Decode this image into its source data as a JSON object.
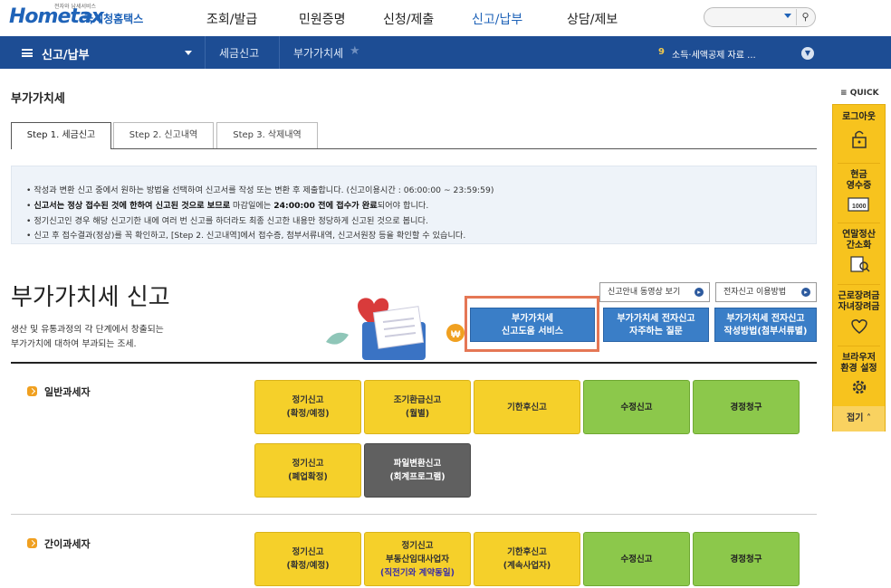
{
  "header": {
    "logo_tagline": "전자와 납세서비스",
    "logo_text": "Hometax",
    "logo_subtitle": "국세청홈택스",
    "nav": [
      "조회/발급",
      "민원증명",
      "신청/제출",
      "신고/납부",
      "상담/제보"
    ]
  },
  "menubar": {
    "title": "신고/납부",
    "crumb1": "세금신고",
    "crumb2": "부가가치세",
    "news_num": "9",
    "news_text": "소득·세액공제 자료 ..."
  },
  "page": {
    "title": "부가가치세",
    "tabs": [
      "Step 1. 세금신고",
      "Step 2. 신고내역",
      "Step 3. 삭제내역"
    ]
  },
  "info": {
    "line1": "작성과 변환 신고 중에서 원하는 방법을 선택하여 신고서를 작성 또는 변환 후 제출합니다. (신고이용시간 : 06:00:00 ~ 23:59:59)",
    "line2_bold1": "신고서는 정상 접수된 것에 한하여 신고된 것으로 보므로",
    "line2_mid": " 마감일에는 ",
    "line2_bold2": "24:00:00 전에 접수가 완료",
    "line2_end": "되어야 합니다.",
    "line3": "정기신고인 경우 해당 신고기한 내에 여러 번 신고를 하더라도 최종 신고한 내용만 정당하게 신고된 것으로 봅니다.",
    "line4": "신고 후 접수결과(정상)를 꼭 확인하고, [Step 2. 신고내역]에서 접수증, 첨부서류내역, 신고서원장 등을 확인할 수 있습니다."
  },
  "hero": {
    "title": "부가가치세 신고",
    "desc1": "생산 및 유통과정의 각 단계에서 창출되는",
    "desc2": "부가가치에 대하여 부과되는 조세.",
    "video_btn": "신고안내 동영상 보기",
    "howto_btn": "전자신고 이용방법",
    "help1a": "부가가치세",
    "help1b": "신고도움 서비스",
    "help2a": "부가가치세 전자신고",
    "help2b": "자주하는 질문",
    "help3a": "부가가치세 전자신고",
    "help3b": "작성방법(첨부서류별)"
  },
  "general": {
    "label": "일반과세자",
    "b1a": "정기신고",
    "b1b": "(확정/예정)",
    "b2a": "조기환급신고",
    "b2b": "(월별)",
    "b3": "기한후신고",
    "b4": "수정신고",
    "b5": "경정청구",
    "b6a": "정기신고",
    "b6b": "(폐업확정)",
    "b7a": "파일변환신고",
    "b7b": "(회계프로그램)"
  },
  "simple": {
    "label": "간이과세자",
    "b1a": "정기신고",
    "b1b": "(확정/예정)",
    "b2a": "정기신고",
    "b2b": "부동산임대사업자",
    "b2c": "(직전기와 계약동일)",
    "b3a": "기한후신고",
    "b3b": "(계속사업자)",
    "b4": "수정신고",
    "b5": "경정청구"
  },
  "quick": {
    "header": "QUICK",
    "logout": "로그아웃",
    "receipt1": "현금",
    "receipt2": "영수증",
    "yearend1": "연말정산",
    "yearend2": "간소화",
    "labor1": "근로장려금",
    "labor2": "자녀장려금",
    "browser1": "브라우저",
    "browser2": "환경 설정",
    "close": "접기"
  },
  "colors": {
    "accent": "#1d4d94",
    "highlight": "#e57755",
    "yellow": "#f5d02a",
    "green": "#8cc84b"
  }
}
